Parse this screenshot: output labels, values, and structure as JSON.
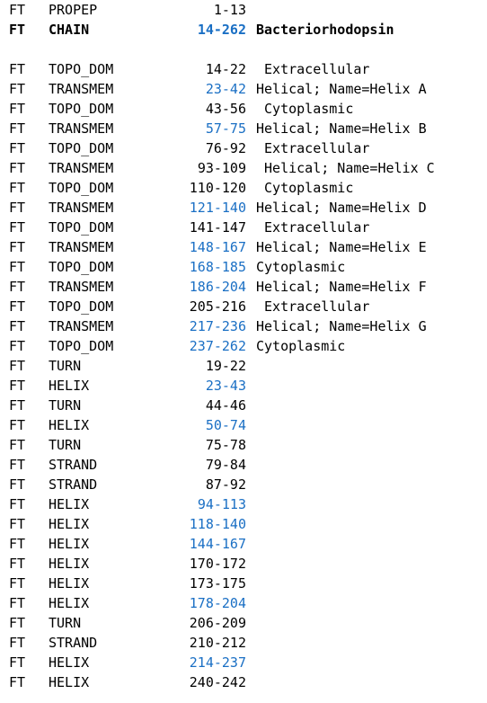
{
  "colors": {
    "highlight": "#1a6fc4",
    "text": "#000000",
    "background": "#ffffff"
  },
  "table": {
    "rows": [
      {
        "key": "FT",
        "type": "PROPEP",
        "range": "1-13",
        "highlight": false,
        "desc": "",
        "bold": false,
        "spacer_after": false
      },
      {
        "key": "FT",
        "type": "CHAIN",
        "range": "14-262",
        "highlight": true,
        "desc": "Bacteriorhodopsin",
        "bold": true,
        "spacer_after": true
      },
      {
        "key": "FT",
        "type": "TOPO_DOM",
        "range": "14-22",
        "highlight": false,
        "desc": " Extracellular",
        "bold": false,
        "spacer_after": false
      },
      {
        "key": "FT",
        "type": "TRANSMEM",
        "range": "23-42",
        "highlight": true,
        "desc": "Helical; Name=Helix A",
        "bold": false,
        "spacer_after": false
      },
      {
        "key": "FT",
        "type": "TOPO_DOM",
        "range": "43-56",
        "highlight": false,
        "desc": " Cytoplasmic",
        "bold": false,
        "spacer_after": false
      },
      {
        "key": "FT",
        "type": "TRANSMEM",
        "range": "57-75",
        "highlight": true,
        "desc": "Helical; Name=Helix B",
        "bold": false,
        "spacer_after": false
      },
      {
        "key": "FT",
        "type": "TOPO_DOM",
        "range": "76-92",
        "highlight": false,
        "desc": " Extracellular",
        "bold": false,
        "spacer_after": false
      },
      {
        "key": "FT",
        "type": "TRANSMEM",
        "range": "93-109",
        "highlight": false,
        "desc": " Helical; Name=Helix C",
        "bold": false,
        "spacer_after": false
      },
      {
        "key": "FT",
        "type": "TOPO_DOM",
        "range": "110-120",
        "highlight": false,
        "desc": " Cytoplasmic",
        "bold": false,
        "spacer_after": false
      },
      {
        "key": "FT",
        "type": "TRANSMEM",
        "range": "121-140",
        "highlight": true,
        "desc": "Helical; Name=Helix D",
        "bold": false,
        "spacer_after": false
      },
      {
        "key": "FT",
        "type": "TOPO_DOM",
        "range": "141-147",
        "highlight": false,
        "desc": " Extracellular",
        "bold": false,
        "spacer_after": false
      },
      {
        "key": "FT",
        "type": "TRANSMEM",
        "range": "148-167",
        "highlight": true,
        "desc": "Helical; Name=Helix E",
        "bold": false,
        "spacer_after": false
      },
      {
        "key": "FT",
        "type": "TOPO_DOM",
        "range": "168-185",
        "highlight": true,
        "desc": "Cytoplasmic",
        "bold": false,
        "spacer_after": false
      },
      {
        "key": "FT",
        "type": "TRANSMEM",
        "range": "186-204",
        "highlight": true,
        "desc": "Helical; Name=Helix F",
        "bold": false,
        "spacer_after": false
      },
      {
        "key": "FT",
        "type": "TOPO_DOM",
        "range": "205-216",
        "highlight": false,
        "desc": " Extracellular",
        "bold": false,
        "spacer_after": false
      },
      {
        "key": "FT",
        "type": "TRANSMEM",
        "range": "217-236",
        "highlight": true,
        "desc": "Helical; Name=Helix G",
        "bold": false,
        "spacer_after": false
      },
      {
        "key": "FT",
        "type": "TOPO_DOM",
        "range": "237-262",
        "highlight": true,
        "desc": "Cytoplasmic",
        "bold": false,
        "spacer_after": false
      },
      {
        "key": "FT",
        "type": "TURN",
        "range": "19-22",
        "highlight": false,
        "desc": "",
        "bold": false,
        "spacer_after": false
      },
      {
        "key": "FT",
        "type": "HELIX",
        "range": "23-43",
        "highlight": true,
        "desc": "",
        "bold": false,
        "spacer_after": false
      },
      {
        "key": "FT",
        "type": "TURN",
        "range": "44-46",
        "highlight": false,
        "desc": "",
        "bold": false,
        "spacer_after": false
      },
      {
        "key": "FT",
        "type": "HELIX",
        "range": "50-74",
        "highlight": true,
        "desc": "",
        "bold": false,
        "spacer_after": false
      },
      {
        "key": "FT",
        "type": "TURN",
        "range": "75-78",
        "highlight": false,
        "desc": "",
        "bold": false,
        "spacer_after": false
      },
      {
        "key": "FT",
        "type": "STRAND",
        "range": "79-84",
        "highlight": false,
        "desc": "",
        "bold": false,
        "spacer_after": false
      },
      {
        "key": "FT",
        "type": "STRAND",
        "range": "87-92",
        "highlight": false,
        "desc": "",
        "bold": false,
        "spacer_after": false
      },
      {
        "key": "FT",
        "type": "HELIX",
        "range": "94-113",
        "highlight": true,
        "desc": "",
        "bold": false,
        "spacer_after": false
      },
      {
        "key": "FT",
        "type": "HELIX",
        "range": "118-140",
        "highlight": true,
        "desc": "",
        "bold": false,
        "spacer_after": false
      },
      {
        "key": "FT",
        "type": "HELIX",
        "range": "144-167",
        "highlight": true,
        "desc": "",
        "bold": false,
        "spacer_after": false
      },
      {
        "key": "FT",
        "type": "HELIX",
        "range": "170-172",
        "highlight": false,
        "desc": "",
        "bold": false,
        "spacer_after": false
      },
      {
        "key": "FT",
        "type": "HELIX",
        "range": "173-175",
        "highlight": false,
        "desc": "",
        "bold": false,
        "spacer_after": false
      },
      {
        "key": "FT",
        "type": "HELIX",
        "range": "178-204",
        "highlight": true,
        "desc": "",
        "bold": false,
        "spacer_after": false
      },
      {
        "key": "FT",
        "type": "TURN",
        "range": "206-209",
        "highlight": false,
        "desc": "",
        "bold": false,
        "spacer_after": false
      },
      {
        "key": "FT",
        "type": "STRAND",
        "range": "210-212",
        "highlight": false,
        "desc": "",
        "bold": false,
        "spacer_after": false
      },
      {
        "key": "FT",
        "type": "HELIX",
        "range": "214-237",
        "highlight": true,
        "desc": "",
        "bold": false,
        "spacer_after": false
      },
      {
        "key": "FT",
        "type": "HELIX",
        "range": "240-242",
        "highlight": false,
        "desc": "",
        "bold": false,
        "spacer_after": false
      }
    ]
  }
}
